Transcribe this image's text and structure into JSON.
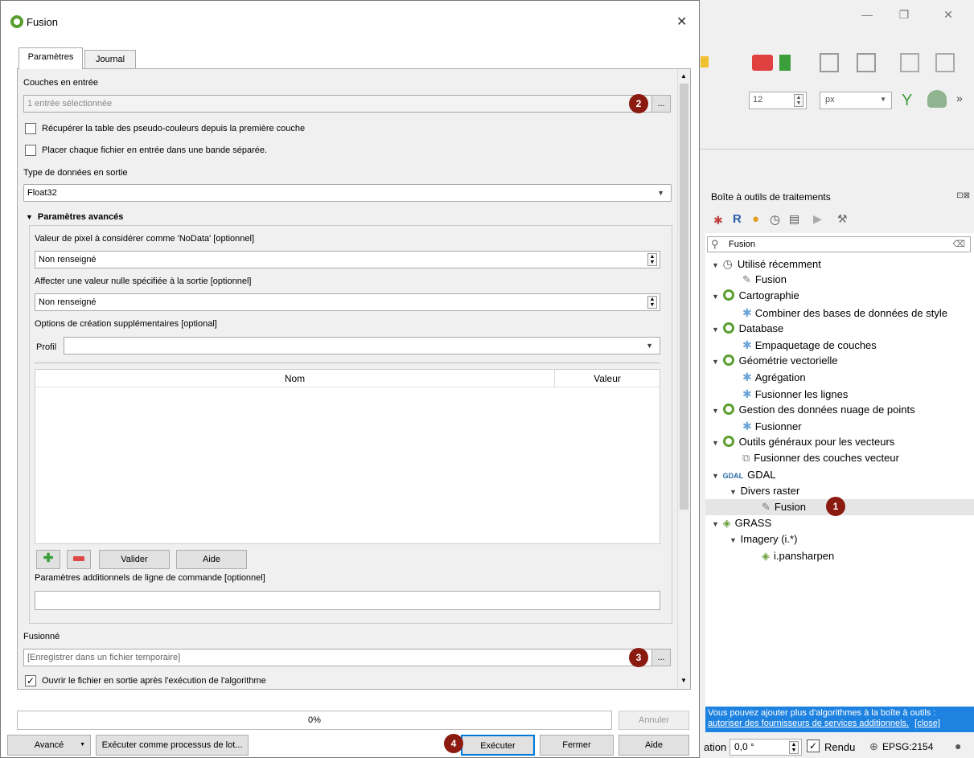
{
  "dialog": {
    "title": "Fusion",
    "tabs": [
      "Paramètres",
      "Journal"
    ],
    "input_layers_label": "Couches en entrée",
    "input_layers_value": "1 entrée sélectionnée",
    "chk_pct_label": "Récupérer la table des pseudo-couleurs depuis la première couche",
    "chk_sep_label": "Placer chaque fichier en entrée dans une bande séparée.",
    "datatype_label": "Type de données en sortie",
    "datatype_value": "Float32",
    "advanced_header": "Paramètres avancés",
    "nodata_label": "Valeur de pixel à considérer comme 'NoData' [optionnel]",
    "nodata_value": "Non renseigné",
    "nullval_label": "Affecter une valeur nulle spécifiée à la sortie [optionnel]",
    "nullval_value": "Non renseigné",
    "create_opts_label": "Options de création supplémentaires [optional]",
    "profile_label": "Profil",
    "table_col_name": "Nom",
    "table_col_value": "Valeur",
    "validate_btn": "Valider",
    "help_small_btn": "Aide",
    "extra_params_label": "Paramètres additionnels de ligne de commande [optionnel]",
    "output_label": "Fusionné",
    "output_placeholder": "[Enregistrer dans un fichier temporaire]",
    "open_output_label": "Ouvrir le fichier en sortie après l'exécution de l'algorithme",
    "progress_text": "0%",
    "progress": 0,
    "cancel_btn": "Annuler",
    "advanced_btn": "Avancé",
    "batch_btn": "Exécuter comme processus de lot...",
    "run_btn": "Exécuter",
    "close_btn": "Fermer",
    "help_btn": "Aide",
    "browse_dots": "...",
    "browse_dots_menu": "...",
    "close_x": "✕"
  },
  "badges": [
    "1",
    "2",
    "3",
    "4"
  ],
  "qgis": {
    "font_size_value": "12",
    "font_unit": "px",
    "toolbox_title": "Boîte à outils de traitements",
    "search_value": "Fusion",
    "tree": [
      {
        "label": "Utilisé récemment",
        "icon": "clock-icon",
        "level": 0
      },
      {
        "label": "Fusion",
        "icon": "script-icon",
        "level": 1
      },
      {
        "label": "Cartographie",
        "icon": "qgis-icon",
        "level": 0
      },
      {
        "label": "Combiner des bases de données de style",
        "icon": "gear-icon",
        "level": 1
      },
      {
        "label": "Database",
        "icon": "qgis-icon",
        "level": 0
      },
      {
        "label": "Empaquetage de couches",
        "icon": "gear-icon",
        "level": 1
      },
      {
        "label": "Géométrie vectorielle",
        "icon": "qgis-icon",
        "level": 0
      },
      {
        "label": "Agrégation",
        "icon": "gear-icon",
        "level": 1
      },
      {
        "label": "Fusionner les lignes",
        "icon": "gear-icon",
        "level": 1
      },
      {
        "label": "Gestion des données nuage de points",
        "icon": "qgis-icon",
        "level": 0
      },
      {
        "label": "Fusionner",
        "icon": "gear-icon",
        "level": 1
      },
      {
        "label": "Outils généraux pour les vecteurs",
        "icon": "qgis-icon",
        "level": 0
      },
      {
        "label": "Fusionner des couches vecteur",
        "icon": "merge-icon",
        "level": 1
      },
      {
        "label": "GDAL",
        "icon": "gdal-icon",
        "level": 0
      },
      {
        "label": "Divers raster",
        "icon": "",
        "level": 1
      },
      {
        "label": "Fusion",
        "icon": "script-icon",
        "level": 2
      },
      {
        "label": "GRASS",
        "icon": "grass-icon",
        "level": 0
      },
      {
        "label": "Imagery (i.*)",
        "icon": "",
        "level": 1
      },
      {
        "label": "i.pansharpen",
        "icon": "grass-icon",
        "level": 2
      }
    ],
    "info_text": "Vous pouvez ajouter plus d'algorithmes à la boîte à outils :",
    "info_link": "autoriser des fournisseurs de services additionnels.",
    "info_close": "[close]",
    "status_rotation_label": "ation",
    "status_rotation_value": "0,0 °",
    "status_render": "Rendu",
    "status_crs": "EPSG:2154",
    "gdal_short": "GDAL"
  }
}
